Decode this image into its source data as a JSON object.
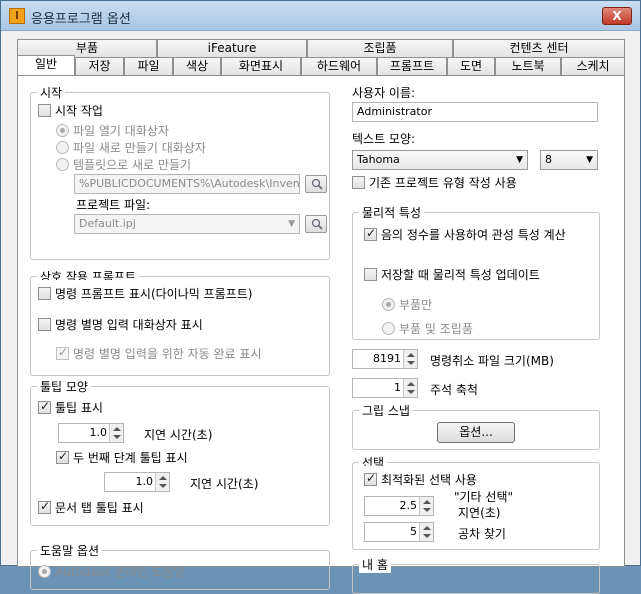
{
  "window": {
    "title": "응용프로그램 옵션",
    "close": "X",
    "app_icon_letter": "I"
  },
  "tabs_back": [
    "부품",
    "iFeature",
    "조립품",
    "컨텐츠 센터"
  ],
  "tabs_front": [
    "일반",
    "저장",
    "파일",
    "색상",
    "화면표시",
    "하드웨어",
    "프롬프트",
    "도면",
    "노트북",
    "스케치"
  ],
  "startup": {
    "title": "시작",
    "startup_action": "시작 작업",
    "open_file_dialog": "파일 열기 대화상자",
    "new_file_dialog": "파일 새로 만들기 대화상자",
    "from_template": "템플릿으로 새로 만들기",
    "template_path": "%PUBLICDOCUMENTS%\\Autodesk\\Inventc",
    "project_file_label": "프로젝트 파일:",
    "project_file": "Default.ipj"
  },
  "prompt": {
    "title": "상호 작용 프롬프트",
    "command_prompt": "명령 프롬프트 표시(다이나믹 프롬프트)",
    "alias_dialog": "명령 별명 입력 대화상자 표시",
    "alias_autocomplete": "명령 별명 입력을 위한 자동 완료 표시"
  },
  "tooltip": {
    "title": "툴팁 모양",
    "show_tooltips": "툴팁 표시",
    "delay_value": "1.0",
    "delay_label": "지연 시간(초)",
    "second_level": "두 번째 단계 툴팁 표시",
    "second_delay_value": "1.0",
    "second_delay_label": "지연 시간(초)",
    "doc_tab_tooltips": "문서 탭 툴팁 표시"
  },
  "help": {
    "title": "도움말 옵션",
    "item": "Autodesk 온라인 도움말"
  },
  "user": {
    "name_label": "사용자 이름:",
    "name_value": "Administrator",
    "text_label": "텍스트 모양:",
    "font": "Tahoma",
    "font_size": "8",
    "use_default_project_type": "기존 프로젝트 유형 작성 사용"
  },
  "physical": {
    "title": "물리적 특성",
    "negative_integer": "음의 정수를 사용하여 관성 특성 계산",
    "update_on_save": "저장할 때 물리적 특성 업데이트",
    "parts_only": "부품만",
    "parts_and_assemblies": "부품 및 조립품"
  },
  "undo": {
    "value": "8191",
    "label": "명령취소 파일 크기(MB)"
  },
  "annotation": {
    "value": "1",
    "label": "주석 축척"
  },
  "grid_snap": {
    "title": "그립 스냅",
    "options_button": "옵션..."
  },
  "selection": {
    "title": "선택",
    "optimized": "최적화된 선택 사용",
    "other_select_label": "\"기타 선택\"",
    "delay_label": "지연(초)",
    "delay_value": "2.5",
    "tolerance_label": "공차 찾기",
    "tolerance_value": "5"
  },
  "bottom_right": {
    "title": "내 홈"
  }
}
